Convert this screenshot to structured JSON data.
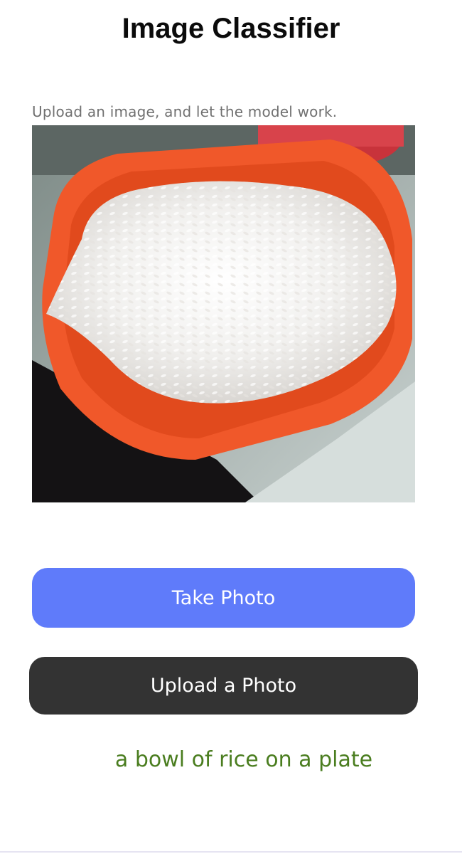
{
  "header": {
    "title": "Image Classifier"
  },
  "upload_section": {
    "instructions": "Upload an image, and let the model work."
  },
  "preview": {
    "image_description_icon": "photo-rice-plate-icon"
  },
  "actions": {
    "take_photo_label": "Take Photo",
    "upload_photo_label": "Upload a Photo"
  },
  "result": {
    "caption": "a bowl of rice on a plate"
  },
  "colors": {
    "take_photo_bg": "#5f7bfa",
    "upload_photo_bg": "#333333",
    "result_text": "#4a7d1f",
    "title_text": "#0b0b0b"
  }
}
